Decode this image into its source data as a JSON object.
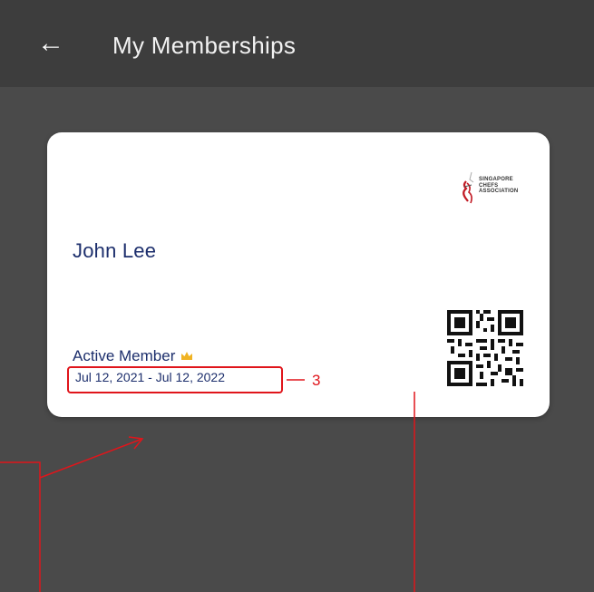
{
  "header": {
    "back_icon": "←",
    "title": "My Memberships"
  },
  "card": {
    "logo_lines": [
      "SINGAPORE",
      "CHEFS",
      "ASSOCIATION"
    ],
    "member_name": "John Lee",
    "status": "Active Member",
    "status_icon": "crown-icon",
    "date_range": "Jul 12, 2021 - Jul 12, 2022",
    "qr_icon": "qr-code-icon"
  },
  "annotations": {
    "label_3": "3",
    "color": "#e0151b"
  },
  "colors": {
    "background": "#4a4a4a",
    "appbar": "#3d3d3d",
    "card": "#ffffff",
    "text_primary": "#1c2e6c"
  }
}
